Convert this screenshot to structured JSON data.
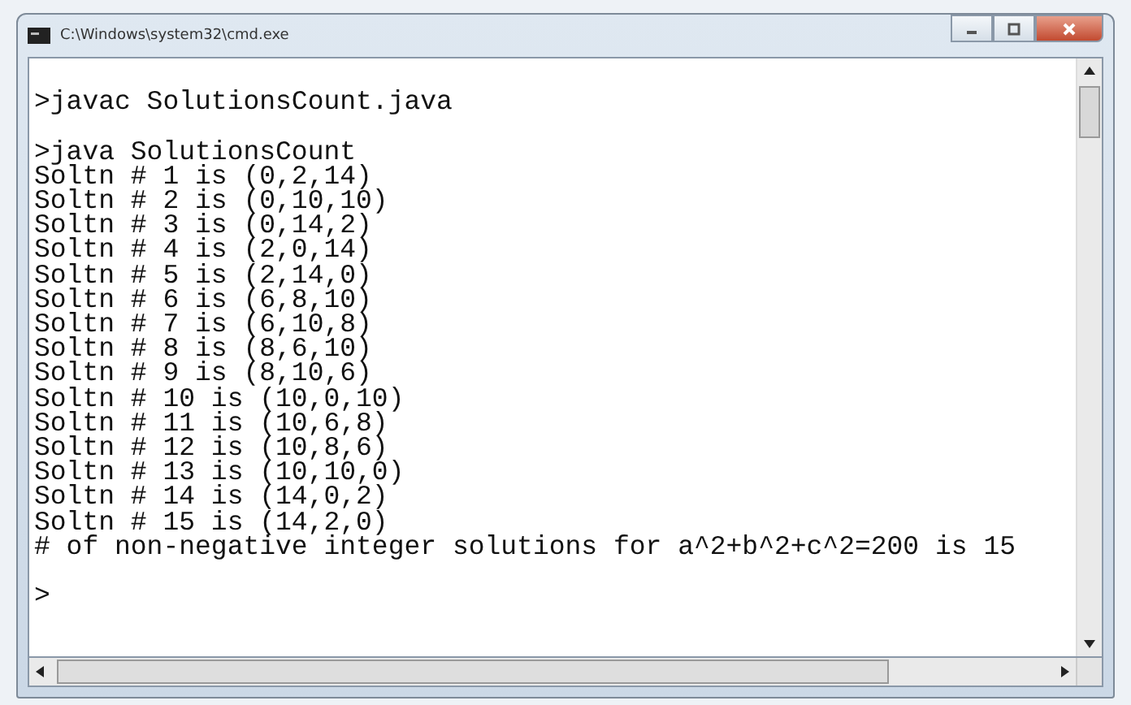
{
  "window": {
    "title": "C:\\Windows\\system32\\cmd.exe"
  },
  "console": {
    "lines": [
      {
        "text": ">javac SolutionsCount.java",
        "blank_before": true
      },
      {
        "text": ">java SolutionsCount",
        "blank_before": true
      },
      {
        "text": "Soltn # 1 is (0,2,14)",
        "blank_before": false
      },
      {
        "text": "Soltn # 2 is (0,10,10)",
        "blank_before": false
      },
      {
        "text": "Soltn # 3 is (0,14,2)",
        "blank_before": false
      },
      {
        "text": "Soltn # 4 is (2,0,14)",
        "blank_before": false
      },
      {
        "text": "Soltn # 5 is (2,14,0)",
        "blank_before": false
      },
      {
        "text": "Soltn # 6 is (6,8,10)",
        "blank_before": false
      },
      {
        "text": "Soltn # 7 is (6,10,8)",
        "blank_before": false
      },
      {
        "text": "Soltn # 8 is (8,6,10)",
        "blank_before": false
      },
      {
        "text": "Soltn # 9 is (8,10,6)",
        "blank_before": false
      },
      {
        "text": "Soltn # 10 is (10,0,10)",
        "blank_before": false
      },
      {
        "text": "Soltn # 11 is (10,6,8)",
        "blank_before": false
      },
      {
        "text": "Soltn # 12 is (10,8,6)",
        "blank_before": false
      },
      {
        "text": "Soltn # 13 is (10,10,0)",
        "blank_before": false
      },
      {
        "text": "Soltn # 14 is (14,0,2)",
        "blank_before": false
      },
      {
        "text": "Soltn # 15 is (14,2,0)",
        "blank_before": false
      },
      {
        "text": "# of non-negative integer solutions for a^2+b^2+c^2=200 is 15",
        "blank_before": false
      },
      {
        "text": ">",
        "blank_before": true
      }
    ]
  }
}
